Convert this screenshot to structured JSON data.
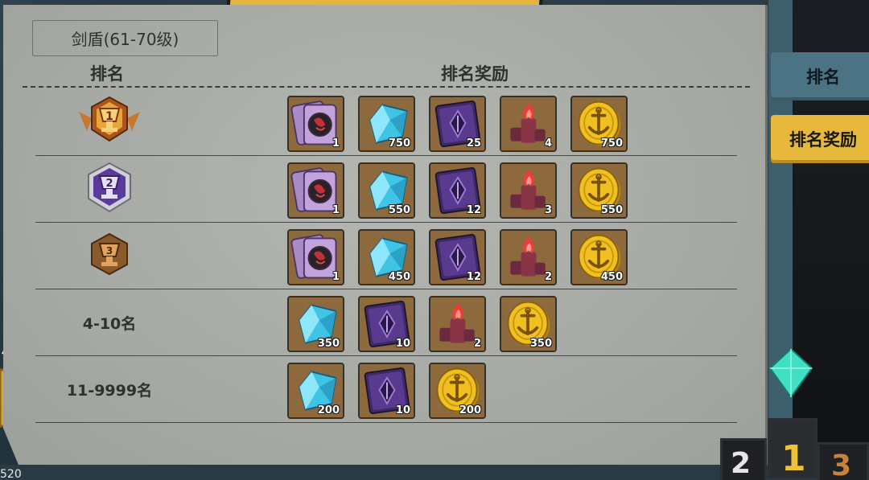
{
  "panel": {
    "category": "剑盾(61-70级)",
    "header_rank": "排名",
    "header_reward": "排名奖励"
  },
  "rows": [
    {
      "rank_label": "1",
      "rank_type": "gold-trophy-badge",
      "items": [
        {
          "icon": "card-pack-icon",
          "qty": "1"
        },
        {
          "icon": "blue-crystal-icon",
          "qty": "750"
        },
        {
          "icon": "purple-tome-icon",
          "qty": "25"
        },
        {
          "icon": "red-flame-stone-icon",
          "qty": "4"
        },
        {
          "icon": "gold-anchor-coin-icon",
          "qty": "750"
        }
      ]
    },
    {
      "rank_label": "2",
      "rank_type": "purple-trophy-badge",
      "items": [
        {
          "icon": "card-pack-icon",
          "qty": "1"
        },
        {
          "icon": "blue-crystal-icon",
          "qty": "550"
        },
        {
          "icon": "purple-tome-icon",
          "qty": "12"
        },
        {
          "icon": "red-flame-stone-icon",
          "qty": "3"
        },
        {
          "icon": "gold-anchor-coin-icon",
          "qty": "550"
        }
      ]
    },
    {
      "rank_label": "3",
      "rank_type": "bronze-trophy-badge",
      "items": [
        {
          "icon": "card-pack-icon",
          "qty": "1"
        },
        {
          "icon": "blue-crystal-icon",
          "qty": "450"
        },
        {
          "icon": "purple-tome-icon",
          "qty": "12"
        },
        {
          "icon": "red-flame-stone-icon",
          "qty": "2"
        },
        {
          "icon": "gold-anchor-coin-icon",
          "qty": "450"
        }
      ]
    },
    {
      "rank_label": "4-10名",
      "rank_type": "text",
      "items": [
        {
          "icon": "blue-crystal-icon",
          "qty": "350"
        },
        {
          "icon": "purple-tome-icon",
          "qty": "10"
        },
        {
          "icon": "red-flame-stone-icon",
          "qty": "2"
        },
        {
          "icon": "gold-anchor-coin-icon",
          "qty": "350"
        }
      ]
    },
    {
      "rank_label": "11-9999名",
      "rank_type": "text",
      "items": [
        {
          "icon": "blue-crystal-icon",
          "qty": "200"
        },
        {
          "icon": "purple-tome-icon",
          "qty": "10"
        },
        {
          "icon": "gold-anchor-coin-icon",
          "qty": "200"
        }
      ]
    }
  ],
  "tabs": {
    "rank": "排名",
    "reward": "排名奖励"
  },
  "podium": {
    "first": "1",
    "second": "2",
    "third": "3"
  },
  "corner_number": "520",
  "colors": {
    "panel_bg": "#a8aba6",
    "tab_active": "#e6b83b",
    "tab_inactive": "#4c7384",
    "item_frame": "#8f6c3d"
  }
}
